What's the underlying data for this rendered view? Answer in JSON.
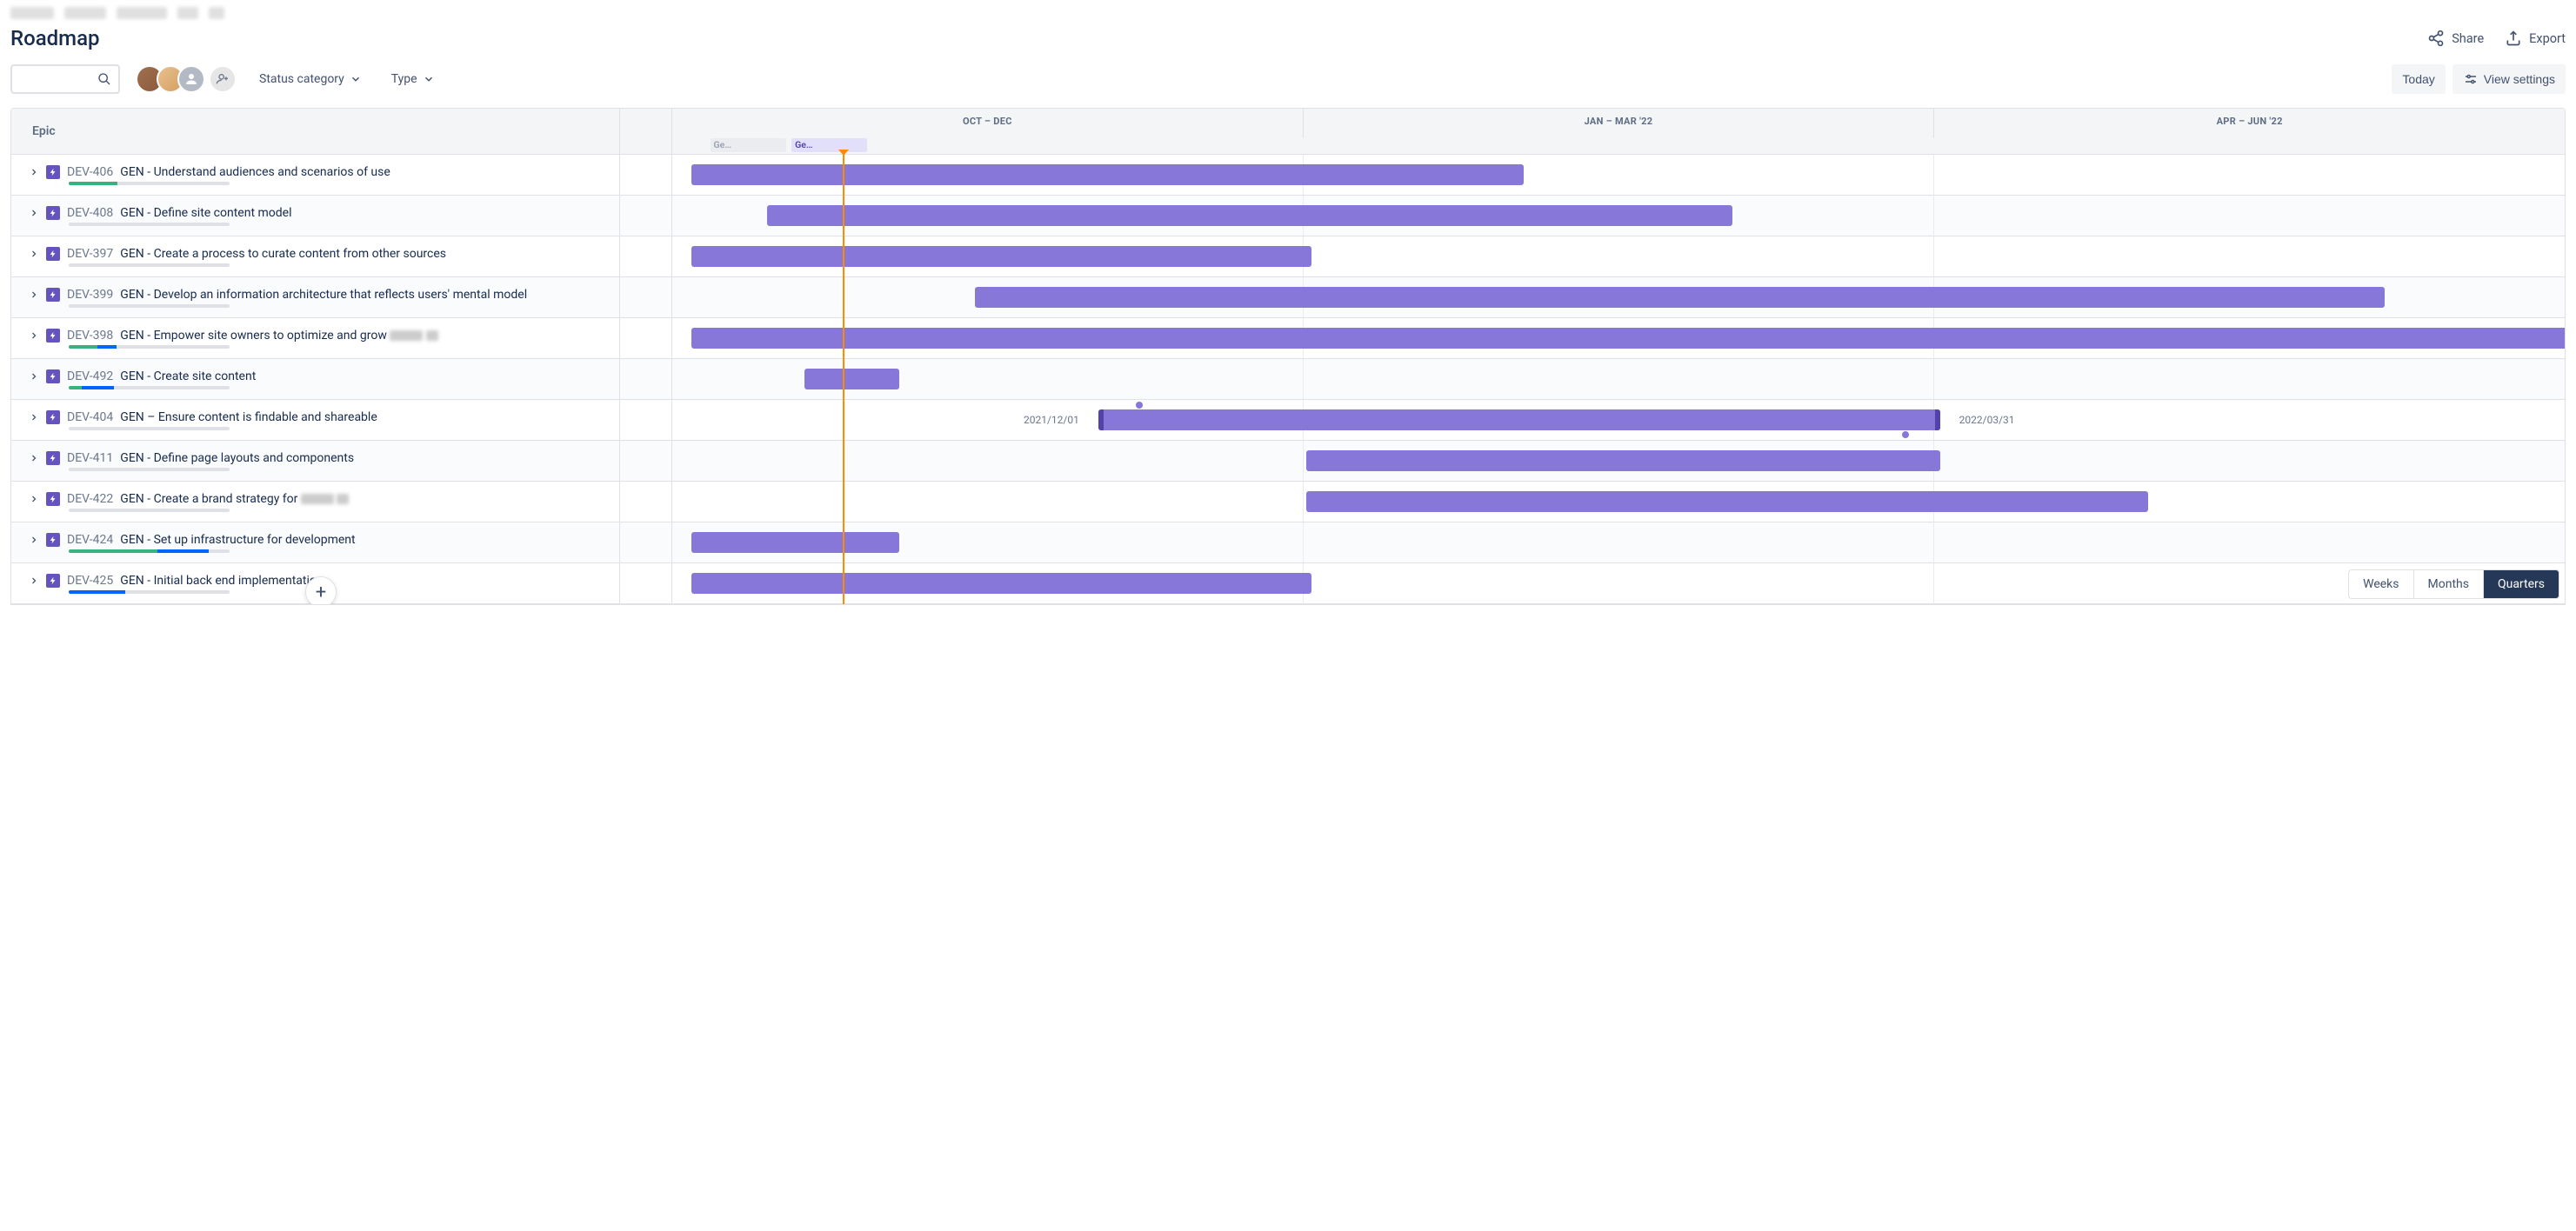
{
  "header": {
    "title": "Roadmap",
    "share_label": "Share",
    "export_label": "Export"
  },
  "toolbar": {
    "filters": {
      "status_label": "Status category",
      "type_label": "Type"
    },
    "today_label": "Today",
    "view_settings_label": "View settings"
  },
  "columns": {
    "epic_label": "Epic"
  },
  "timeline": {
    "periods": [
      "OCT – DEC",
      "JAN – MAR '22",
      "APR – JUN '22"
    ],
    "releases": [
      {
        "label": "Ge…",
        "state": "inactive",
        "left_pct": 2.0,
        "width_pct": 4.0
      },
      {
        "label": "Ge…",
        "state": "active",
        "left_pct": 6.3,
        "width_pct": 4.0
      }
    ],
    "today_position_pct": 9.0
  },
  "epics": [
    {
      "key": "DEV-406",
      "title": "GEN - Understand audiences and scenarios of use",
      "progress": {
        "green": 30,
        "blue": 0
      },
      "bar": {
        "left_pct": 1.0,
        "width_pct": 44.0
      }
    },
    {
      "key": "DEV-408",
      "title": "GEN - Define site content model",
      "progress": {
        "green": 0,
        "blue": 0
      },
      "bar": {
        "left_pct": 5.0,
        "width_pct": 51.0
      }
    },
    {
      "key": "DEV-397",
      "title": "GEN - Create a process to curate content from other sources",
      "progress": {
        "green": 0,
        "blue": 0
      },
      "bar": {
        "left_pct": 1.0,
        "width_pct": 32.8
      }
    },
    {
      "key": "DEV-399",
      "title": "GEN - Develop an information architecture that reflects users' mental model",
      "progress": {
        "green": 0,
        "blue": 0
      },
      "bar": {
        "left_pct": 16.0,
        "width_pct": 74.5
      }
    },
    {
      "key": "DEV-398",
      "title": "GEN - Empower site owners to optimize and grow",
      "has_blur_suffix": true,
      "progress": {
        "green": 18,
        "blue": 12
      },
      "bar": {
        "left_pct": 1.0,
        "width_pct": 99.0,
        "overflow_right": true
      }
    },
    {
      "key": "DEV-492",
      "title": "GEN - Create site content",
      "progress": {
        "green": 8,
        "blue": 20
      },
      "bar": {
        "left_pct": 7.0,
        "width_pct": 5.0
      }
    },
    {
      "key": "DEV-404",
      "title": "GEN – Ensure content is findable and shareable",
      "progress": {
        "green": 0,
        "blue": 0
      },
      "bar": {
        "left_pct": 22.5,
        "width_pct": 44.5,
        "start_cap": true,
        "end_cap": true
      },
      "date_start": "2021/12/01",
      "date_end": "2022/03/31",
      "dep_dots": [
        {
          "left_pct": 24.5,
          "y": "top"
        },
        {
          "left_pct": 65.0,
          "y": "bottom"
        }
      ]
    },
    {
      "key": "DEV-411",
      "title": "GEN - Define page layouts and components",
      "progress": {
        "green": 0,
        "blue": 0
      },
      "bar": {
        "left_pct": 33.5,
        "width_pct": 33.5
      }
    },
    {
      "key": "DEV-422",
      "title": "GEN - Create a brand strategy for",
      "has_blur_suffix": true,
      "progress": {
        "green": 0,
        "blue": 0
      },
      "bar": {
        "left_pct": 33.5,
        "width_pct": 44.5
      }
    },
    {
      "key": "DEV-424",
      "title": "GEN - Set up infrastructure for development",
      "progress": {
        "green": 55,
        "blue": 32
      },
      "bar": {
        "left_pct": 1.0,
        "width_pct": 11.0
      }
    },
    {
      "key": "DEV-425",
      "title": "GEN - Initial back end implementation",
      "title_blur_middle": true,
      "progress": {
        "green": 0,
        "blue": 35
      },
      "bar": {
        "left_pct": 1.0,
        "width_pct": 32.8
      }
    }
  ],
  "zoom": {
    "weeks": "Weeks",
    "months": "Months",
    "quarters": "Quarters",
    "active": "quarters"
  },
  "colors": {
    "epic_bar": "#8777D9",
    "today_line": "#FF8B00",
    "epic_badge": "#6554C0"
  }
}
